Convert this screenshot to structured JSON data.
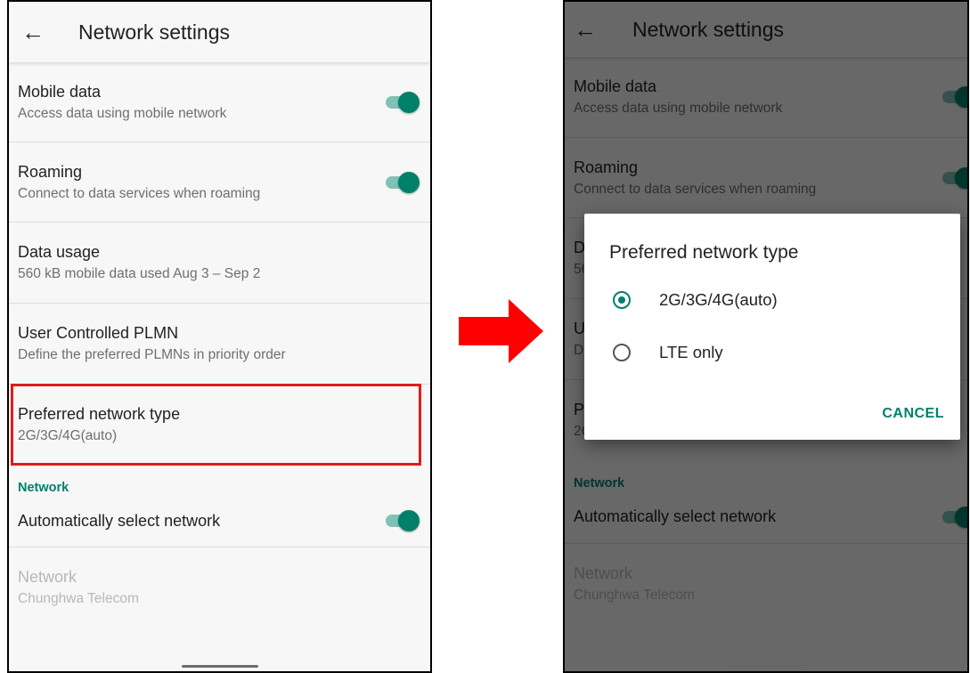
{
  "appbar": {
    "title": "Network settings",
    "back_icon": "arrow-back-icon"
  },
  "settings": {
    "mobile_data": {
      "title": "Mobile data",
      "summary": "Access data using mobile network",
      "enabled": true
    },
    "roaming": {
      "title": "Roaming",
      "summary": "Connect to data services when roaming",
      "enabled": true
    },
    "data_usage": {
      "title": "Data usage",
      "summary": "560 kB mobile data used Aug 3 – Sep 2"
    },
    "user_plmn": {
      "title": "User Controlled PLMN",
      "summary": "Define the preferred PLMNs in priority order"
    },
    "preferred_network": {
      "title": "Preferred network type",
      "summary": "2G/3G/4G(auto)"
    },
    "network_section": "Network",
    "auto_select": {
      "title": "Automatically select network",
      "enabled": true
    },
    "network": {
      "title": "Network",
      "summary": "Chunghwa Telecom",
      "disabled": true
    }
  },
  "dialog": {
    "title": "Preferred network type",
    "options": [
      {
        "label": "2G/3G/4G(auto)",
        "selected": true
      },
      {
        "label": "LTE only",
        "selected": false
      }
    ],
    "cancel_label": "CANCEL"
  },
  "colors": {
    "accent": "#00806b",
    "highlight": "#e21a1a",
    "arrow": "#ff0000"
  }
}
